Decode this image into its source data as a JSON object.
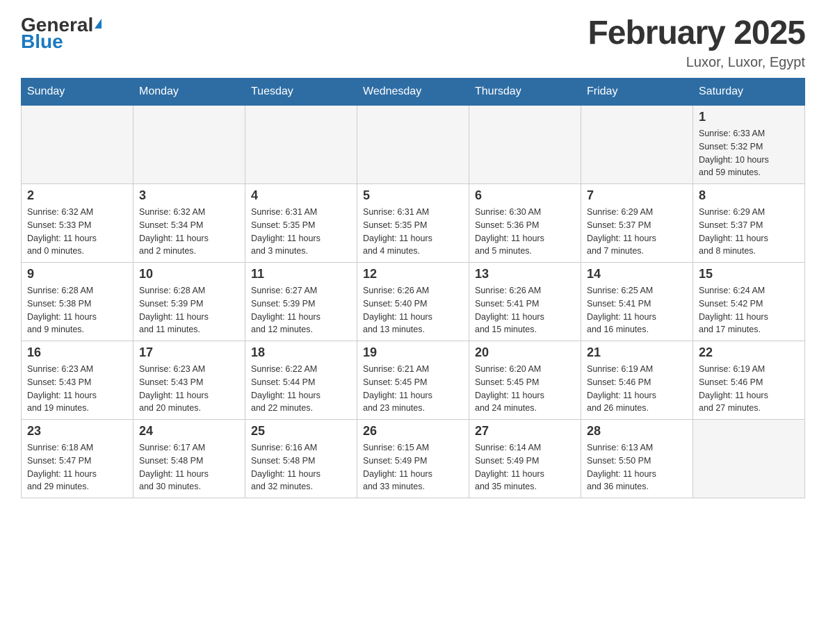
{
  "header": {
    "logo_general": "General",
    "logo_blue": "Blue",
    "month_title": "February 2025",
    "location": "Luxor, Luxor, Egypt"
  },
  "days_of_week": [
    "Sunday",
    "Monday",
    "Tuesday",
    "Wednesday",
    "Thursday",
    "Friday",
    "Saturday"
  ],
  "weeks": [
    {
      "days": [
        {
          "number": "",
          "info": ""
        },
        {
          "number": "",
          "info": ""
        },
        {
          "number": "",
          "info": ""
        },
        {
          "number": "",
          "info": ""
        },
        {
          "number": "",
          "info": ""
        },
        {
          "number": "",
          "info": ""
        },
        {
          "number": "1",
          "info": "Sunrise: 6:33 AM\nSunset: 5:32 PM\nDaylight: 10 hours\nand 59 minutes."
        }
      ]
    },
    {
      "days": [
        {
          "number": "2",
          "info": "Sunrise: 6:32 AM\nSunset: 5:33 PM\nDaylight: 11 hours\nand 0 minutes."
        },
        {
          "number": "3",
          "info": "Sunrise: 6:32 AM\nSunset: 5:34 PM\nDaylight: 11 hours\nand 2 minutes."
        },
        {
          "number": "4",
          "info": "Sunrise: 6:31 AM\nSunset: 5:35 PM\nDaylight: 11 hours\nand 3 minutes."
        },
        {
          "number": "5",
          "info": "Sunrise: 6:31 AM\nSunset: 5:35 PM\nDaylight: 11 hours\nand 4 minutes."
        },
        {
          "number": "6",
          "info": "Sunrise: 6:30 AM\nSunset: 5:36 PM\nDaylight: 11 hours\nand 5 minutes."
        },
        {
          "number": "7",
          "info": "Sunrise: 6:29 AM\nSunset: 5:37 PM\nDaylight: 11 hours\nand 7 minutes."
        },
        {
          "number": "8",
          "info": "Sunrise: 6:29 AM\nSunset: 5:37 PM\nDaylight: 11 hours\nand 8 minutes."
        }
      ]
    },
    {
      "days": [
        {
          "number": "9",
          "info": "Sunrise: 6:28 AM\nSunset: 5:38 PM\nDaylight: 11 hours\nand 9 minutes."
        },
        {
          "number": "10",
          "info": "Sunrise: 6:28 AM\nSunset: 5:39 PM\nDaylight: 11 hours\nand 11 minutes."
        },
        {
          "number": "11",
          "info": "Sunrise: 6:27 AM\nSunset: 5:39 PM\nDaylight: 11 hours\nand 12 minutes."
        },
        {
          "number": "12",
          "info": "Sunrise: 6:26 AM\nSunset: 5:40 PM\nDaylight: 11 hours\nand 13 minutes."
        },
        {
          "number": "13",
          "info": "Sunrise: 6:26 AM\nSunset: 5:41 PM\nDaylight: 11 hours\nand 15 minutes."
        },
        {
          "number": "14",
          "info": "Sunrise: 6:25 AM\nSunset: 5:41 PM\nDaylight: 11 hours\nand 16 minutes."
        },
        {
          "number": "15",
          "info": "Sunrise: 6:24 AM\nSunset: 5:42 PM\nDaylight: 11 hours\nand 17 minutes."
        }
      ]
    },
    {
      "days": [
        {
          "number": "16",
          "info": "Sunrise: 6:23 AM\nSunset: 5:43 PM\nDaylight: 11 hours\nand 19 minutes."
        },
        {
          "number": "17",
          "info": "Sunrise: 6:23 AM\nSunset: 5:43 PM\nDaylight: 11 hours\nand 20 minutes."
        },
        {
          "number": "18",
          "info": "Sunrise: 6:22 AM\nSunset: 5:44 PM\nDaylight: 11 hours\nand 22 minutes."
        },
        {
          "number": "19",
          "info": "Sunrise: 6:21 AM\nSunset: 5:45 PM\nDaylight: 11 hours\nand 23 minutes."
        },
        {
          "number": "20",
          "info": "Sunrise: 6:20 AM\nSunset: 5:45 PM\nDaylight: 11 hours\nand 24 minutes."
        },
        {
          "number": "21",
          "info": "Sunrise: 6:19 AM\nSunset: 5:46 PM\nDaylight: 11 hours\nand 26 minutes."
        },
        {
          "number": "22",
          "info": "Sunrise: 6:19 AM\nSunset: 5:46 PM\nDaylight: 11 hours\nand 27 minutes."
        }
      ]
    },
    {
      "days": [
        {
          "number": "23",
          "info": "Sunrise: 6:18 AM\nSunset: 5:47 PM\nDaylight: 11 hours\nand 29 minutes."
        },
        {
          "number": "24",
          "info": "Sunrise: 6:17 AM\nSunset: 5:48 PM\nDaylight: 11 hours\nand 30 minutes."
        },
        {
          "number": "25",
          "info": "Sunrise: 6:16 AM\nSunset: 5:48 PM\nDaylight: 11 hours\nand 32 minutes."
        },
        {
          "number": "26",
          "info": "Sunrise: 6:15 AM\nSunset: 5:49 PM\nDaylight: 11 hours\nand 33 minutes."
        },
        {
          "number": "27",
          "info": "Sunrise: 6:14 AM\nSunset: 5:49 PM\nDaylight: 11 hours\nand 35 minutes."
        },
        {
          "number": "28",
          "info": "Sunrise: 6:13 AM\nSunset: 5:50 PM\nDaylight: 11 hours\nand 36 minutes."
        },
        {
          "number": "",
          "info": ""
        }
      ]
    }
  ]
}
